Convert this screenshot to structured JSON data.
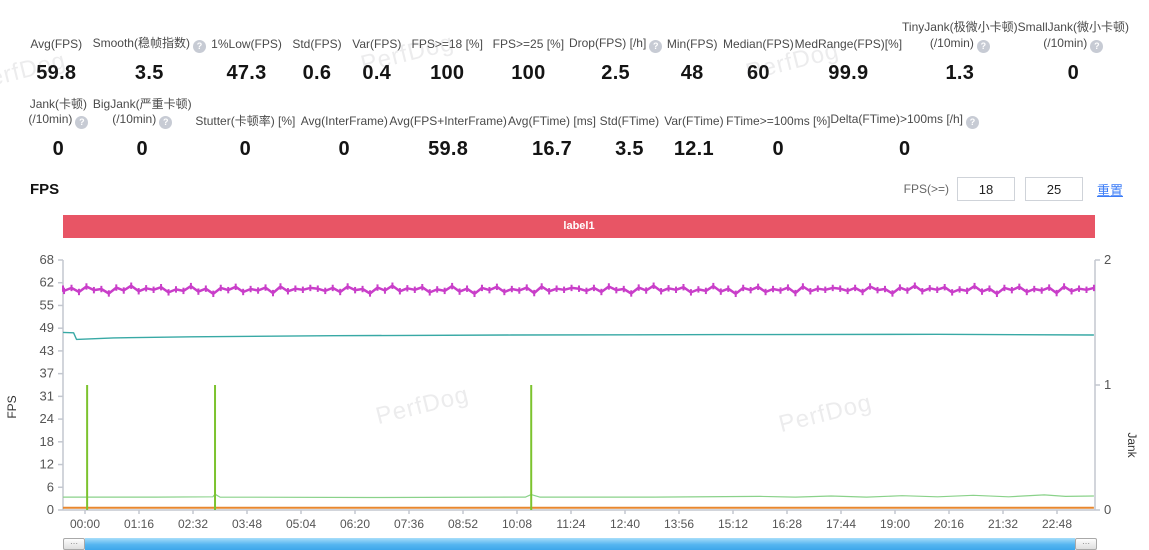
{
  "watermark": "PerfDog",
  "metrics": {
    "row1": [
      {
        "label": [
          "Avg(FPS)"
        ],
        "value": "59.8",
        "help": false
      },
      {
        "label": [
          "Smooth(稳帧指数)"
        ],
        "value": "3.5",
        "help": true
      },
      {
        "label": [
          "1%Low(FPS)"
        ],
        "value": "47.3",
        "help": false
      },
      {
        "label": [
          "Std(FPS)"
        ],
        "value": "0.6",
        "help": false
      },
      {
        "label": [
          "Var(FPS)"
        ],
        "value": "0.4",
        "help": false
      },
      {
        "label": [
          "FPS>=18 [%]"
        ],
        "value": "100",
        "help": false
      },
      {
        "label": [
          "FPS>=25 [%]"
        ],
        "value": "100",
        "help": false
      },
      {
        "label": [
          "Drop(FPS) [/h]"
        ],
        "value": "2.5",
        "help": true
      },
      {
        "label": [
          "Min(FPS)"
        ],
        "value": "48",
        "help": false
      },
      {
        "label": [
          "Median(FPS)"
        ],
        "value": "60",
        "help": false
      },
      {
        "label": [
          "MedRange(FPS)[%]"
        ],
        "value": "99.9",
        "help": false
      },
      {
        "label": [
          "TinyJank(极微小卡顿)",
          "(/10min)"
        ],
        "value": "1.3",
        "help": true
      },
      {
        "label": [
          "SmallJank(微小卡顿)",
          "(/10min)"
        ],
        "value": "0",
        "help": true
      }
    ],
    "row2": [
      {
        "label": [
          "Jank(卡顿)",
          "(/10min)"
        ],
        "value": "0",
        "help": true
      },
      {
        "label": [
          "BigJank(严重卡顿)",
          "(/10min)"
        ],
        "value": "0",
        "help": true
      },
      {
        "label": [
          "Stutter(卡顿率) [%]"
        ],
        "value": "0",
        "help": false
      },
      {
        "label": [
          "Avg(InterFrame)"
        ],
        "value": "0",
        "help": false
      },
      {
        "label": [
          "Avg(FPS+InterFrame)"
        ],
        "value": "59.8",
        "help": false
      },
      {
        "label": [
          "Avg(FTime) [ms]"
        ],
        "value": "16.7",
        "help": false
      },
      {
        "label": [
          "Std(FTime)"
        ],
        "value": "3.5",
        "help": false
      },
      {
        "label": [
          "Var(FTime)"
        ],
        "value": "12.1",
        "help": false
      },
      {
        "label": [
          "FTime>=100ms [%]"
        ],
        "value": "0",
        "help": false
      },
      {
        "label": [
          "Delta(FTime)>100ms [/h]"
        ],
        "value": "0",
        "help": true
      }
    ]
  },
  "section": {
    "title": "FPS",
    "filter_label": "FPS(>=)",
    "min": "18",
    "max": "25",
    "reset_label": "重置"
  },
  "banner": {
    "label": "label1",
    "color": "#e85565"
  },
  "chart_data": {
    "type": "line",
    "y_left": {
      "label": "FPS",
      "ticks": [
        0,
        6,
        12,
        18,
        24,
        31,
        37,
        43,
        49,
        55,
        62,
        68
      ],
      "max": 68
    },
    "y_right": {
      "label": "Jank",
      "ticks": [
        0,
        1,
        2
      ],
      "max": 2
    },
    "x_ticks": [
      "00:00",
      "01:16",
      "02:32",
      "03:48",
      "05:04",
      "06:20",
      "07:36",
      "08:52",
      "10:08",
      "11:24",
      "12:40",
      "13:56",
      "15:12",
      "16:28",
      "17:44",
      "19:00",
      "20:16",
      "21:32",
      "22:48"
    ],
    "x_tick_seconds": 76,
    "series": [
      {
        "id": "stutter-baseline",
        "color": "#e8872e",
        "axis": "left",
        "style": "line",
        "width": 2,
        "points": [
          [
            -40,
            0.6
          ],
          [
            1420,
            0.6
          ]
        ]
      },
      {
        "id": "smooth-line",
        "color": "#8ad28a",
        "axis": "left",
        "style": "line",
        "width": 1.2,
        "points": [
          [
            -40,
            3.5
          ],
          [
            100,
            3.5
          ],
          [
            180,
            3.6
          ],
          [
            183,
            4.3
          ],
          [
            190,
            3.5
          ],
          [
            400,
            3.4
          ],
          [
            620,
            3.5
          ],
          [
            628,
            4.2
          ],
          [
            640,
            3.5
          ],
          [
            800,
            3.5
          ],
          [
            950,
            3.7
          ],
          [
            1000,
            3.5
          ],
          [
            1050,
            3.8
          ],
          [
            1100,
            3.5
          ],
          [
            1150,
            3.9
          ],
          [
            1200,
            3.6
          ],
          [
            1250,
            4.0
          ],
          [
            1300,
            3.6
          ],
          [
            1350,
            4.1
          ],
          [
            1380,
            3.7
          ],
          [
            1420,
            3.8
          ]
        ]
      },
      {
        "id": "jank-spikes",
        "color": "#7cc32e",
        "axis": "right",
        "style": "spikes",
        "width": 2,
        "points": [
          [
            3,
            1
          ],
          [
            183,
            1
          ],
          [
            628,
            1
          ]
        ]
      },
      {
        "id": "low-fps-line",
        "color": "#38a9a5",
        "axis": "left",
        "style": "line",
        "width": 1.4,
        "points": [
          [
            -40,
            48.3
          ],
          [
            -16,
            48.2
          ],
          [
            -12,
            46.4
          ],
          [
            40,
            46.8
          ],
          [
            150,
            47.1
          ],
          [
            350,
            47.4
          ],
          [
            600,
            47.6
          ],
          [
            900,
            47.7
          ],
          [
            1200,
            47.8
          ],
          [
            1420,
            47.6
          ]
        ]
      },
      {
        "id": "fps-line",
        "color": "#c93ec9",
        "axis": "left",
        "style": "jitter",
        "width": 2.5,
        "t0": -40,
        "t1": 1420,
        "values": [
          60.2,
          59.6,
          60.4,
          59.3,
          60.8,
          59.8,
          60.1,
          58.9,
          60.5,
          59.7,
          61.0,
          59.5,
          60.3,
          59.9,
          60.6,
          59.2,
          60.0,
          59.6,
          60.9,
          59.4,
          60.2,
          58.8,
          60.4,
          59.8,
          60.7,
          59.3,
          60.1,
          59.7,
          60.5,
          59.0,
          60.8,
          59.5,
          60.2,
          59.9,
          60.4,
          60.2,
          59.6,
          60.4,
          59.3,
          60.8,
          59.8,
          60.1,
          58.9,
          60.5,
          59.7,
          61.0,
          59.5,
          60.3,
          59.9,
          60.6,
          59.2,
          60.0,
          59.6,
          60.9,
          59.4,
          60.2,
          58.8,
          60.4,
          59.8,
          60.7,
          59.3,
          60.1,
          59.7,
          60.5,
          59.0,
          60.8,
          59.5,
          60.2,
          59.9,
          60.4,
          60.2,
          59.6,
          60.4,
          59.3,
          60.8,
          59.8,
          60.1,
          58.9,
          60.5,
          59.7,
          61.0,
          59.5,
          60.3,
          59.9,
          60.6,
          59.2,
          60.0,
          59.6,
          60.9,
          59.4,
          60.2,
          58.8,
          60.4,
          59.8,
          60.7,
          59.3,
          60.1,
          59.7,
          60.5,
          59.0,
          60.8,
          59.5,
          60.2,
          59.9,
          60.4,
          60.2,
          59.6,
          60.4,
          59.3,
          60.8,
          59.8,
          60.1,
          58.9,
          60.5,
          59.7,
          61.0,
          59.5,
          60.3,
          59.9,
          60.6,
          59.2,
          60.0,
          59.6,
          60.9,
          59.4,
          60.2,
          58.8,
          60.4,
          59.8,
          60.7,
          59.3,
          60.1,
          59.7,
          60.5,
          59.0,
          60.8,
          59.5,
          60.2,
          59.9,
          60.4
        ]
      }
    ]
  }
}
